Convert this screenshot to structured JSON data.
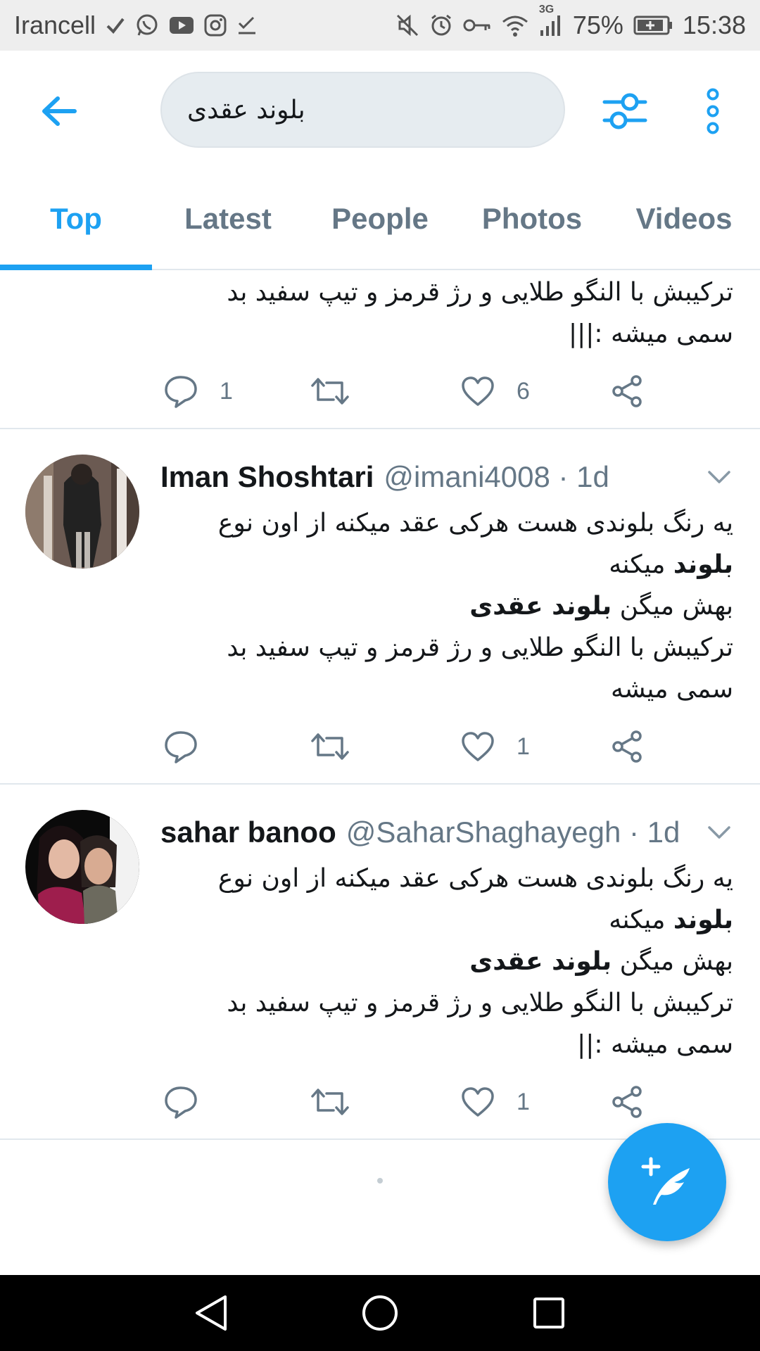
{
  "status_bar": {
    "carrier": "Irancell",
    "battery": "75%",
    "time": "15:38",
    "network": "3G",
    "icons_left": [
      "check-icon",
      "whatsapp-icon",
      "youtube-icon",
      "instagram-icon",
      "checkbox-icon"
    ],
    "icons_right": [
      "mute-icon",
      "alarm-icon",
      "key-icon",
      "wifi-icon",
      "signal-icon",
      "battery-icon"
    ]
  },
  "search": {
    "query": "بلوند عقدی"
  },
  "tabs": [
    {
      "label": "Top",
      "active": true
    },
    {
      "label": "Latest",
      "active": false
    },
    {
      "label": "People",
      "active": false
    },
    {
      "label": "Photos",
      "active": false
    },
    {
      "label": "Videos",
      "active": false
    }
  ],
  "first_tweet": {
    "lines": [
      "ترکیبش با النگو طلایی و رژ قرمز و تیپ سفید بد",
      "سمی میشه :|||"
    ],
    "reply_count": "1",
    "retweet_count": "",
    "like_count": "6"
  },
  "tweets": [
    {
      "name": "Iman Shoshtari",
      "handle": "@imani4008 · 1d",
      "line1": "یه رنگ بلوندی هست هرکی عقد میکنه از اون نوع",
      "line2_bold": "بلوند",
      "line2_rest": " میکنه",
      "line3_pre": "بهش میگن ",
      "line3_bold": "بلوند عقدی",
      "line4": "ترکیبش با النگو طلایی و رژ قرمز و تیپ سفید بد",
      "line5": "سمی میشه",
      "reply_count": "",
      "retweet_count": "",
      "like_count": "1"
    },
    {
      "name": "sahar banoo",
      "handle": "@SaharShaghayegh · 1d",
      "line1": "یه رنگ بلوندی هست هرکی عقد میکنه از اون نوع",
      "line2_bold": "بلوند",
      "line2_rest": " میکنه",
      "line3_pre": "بهش میگن ",
      "line3_bold": "بلوند عقدی",
      "line4": "ترکیبش با النگو طلایی و رژ قرمز و تیپ سفید بد",
      "line5": "سمی میشه :||",
      "reply_count": "",
      "retweet_count": "",
      "like_count": "1"
    }
  ],
  "colors": {
    "accent": "#1da1f2",
    "secondary_text": "#657786",
    "divider": "#e1e8ed",
    "search_bg": "#e6ecf0"
  }
}
